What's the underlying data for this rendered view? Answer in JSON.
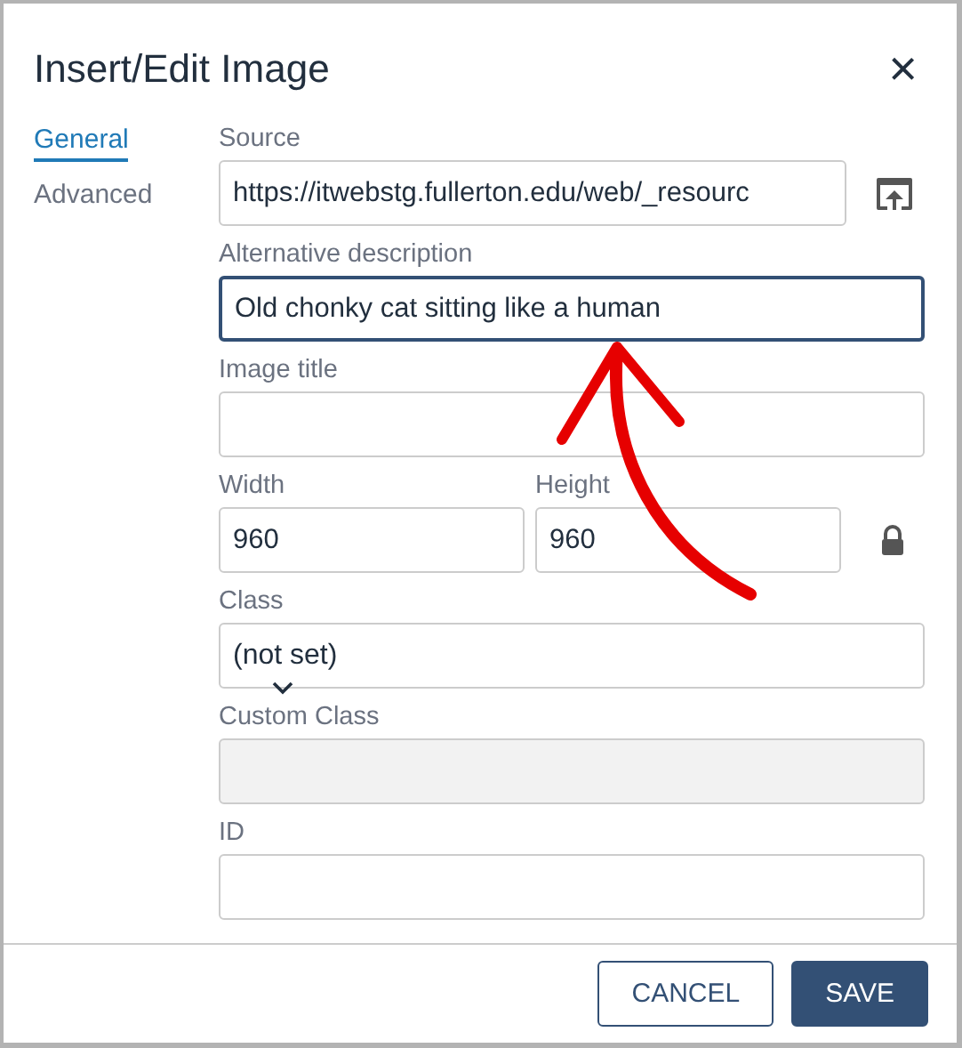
{
  "dialog": {
    "title": "Insert/Edit Image",
    "close": "×"
  },
  "tabs": [
    {
      "label": "General",
      "selected": true
    },
    {
      "label": "Advanced",
      "selected": false
    }
  ],
  "fields": [
    {
      "kind": "url",
      "label": "Source",
      "value": "https://itwebstg.fullerton.edu/web/_resourc",
      "focused": false
    },
    {
      "kind": "text",
      "label": "Alternative description",
      "value": "Old chonky cat sitting like a human",
      "focused": true
    },
    {
      "kind": "text",
      "label": "Image title",
      "focused": false
    },
    {
      "kind": "size",
      "width": {
        "label": "Width",
        "value": "960"
      },
      "height": {
        "label": "Height",
        "value": "960"
      },
      "locked": true
    },
    {
      "kind": "select",
      "label": "Class",
      "value": "(not set)"
    },
    {
      "kind": "text",
      "label": "Custom Class",
      "disabled": true,
      "focused": false
    },
    {
      "kind": "text",
      "label": "ID",
      "focused": false
    }
  ],
  "buttons": [
    {
      "label": "CANCEL",
      "kind": "secondary"
    },
    {
      "label": "SAVE",
      "kind": "primary"
    }
  ]
}
